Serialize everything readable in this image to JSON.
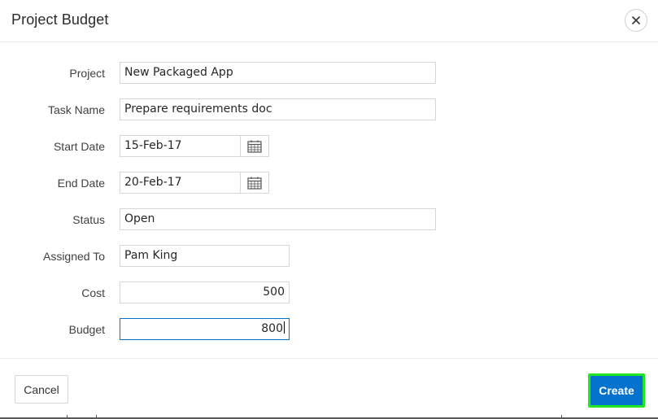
{
  "dialog": {
    "title": "Project Budget",
    "close_icon": "close-icon"
  },
  "form": {
    "project": {
      "label": "Project",
      "value": "New Packaged App"
    },
    "task_name": {
      "label": "Task Name",
      "value": "Prepare requirements doc"
    },
    "start_date": {
      "label": "Start Date",
      "value": "15-Feb-17",
      "icon": "calendar-icon"
    },
    "end_date": {
      "label": "End Date",
      "value": "20-Feb-17",
      "icon": "calendar-icon"
    },
    "status": {
      "label": "Status",
      "value": "Open"
    },
    "assigned_to": {
      "label": "Assigned To",
      "value": "Pam King"
    },
    "cost": {
      "label": "Cost",
      "value": "500"
    },
    "budget": {
      "label": "Budget",
      "value": "800"
    }
  },
  "footer": {
    "cancel_label": "Cancel",
    "create_label": "Create"
  },
  "colors": {
    "primary": "#0572ce",
    "highlight": "#22e622",
    "border": "#d6d6d6"
  }
}
